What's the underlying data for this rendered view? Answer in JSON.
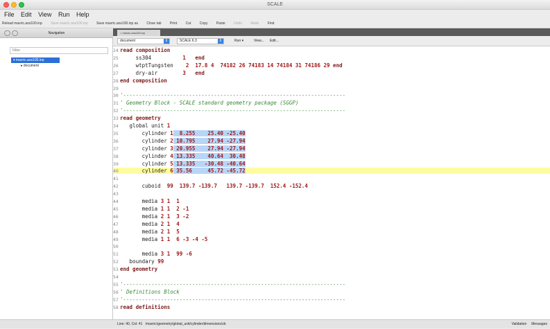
{
  "window": {
    "title": "SCALE"
  },
  "menu": [
    "File",
    "Edit",
    "View",
    "Run",
    "Help"
  ],
  "toolbar": [
    {
      "label": "Reload mavric.aos100.inp",
      "enabled": true
    },
    {
      "label": "Save mavric.aos100.inp",
      "enabled": false
    },
    {
      "label": "Save mavric.aos100.inp as",
      "enabled": true
    },
    {
      "label": "Close tab",
      "enabled": true
    },
    {
      "label": "Print",
      "enabled": true
    },
    {
      "label": "Cut",
      "enabled": true
    },
    {
      "label": "Copy",
      "enabled": true
    },
    {
      "label": "Paste",
      "enabled": true
    },
    {
      "label": "Undo",
      "enabled": false
    },
    {
      "label": "Redo",
      "enabled": false
    },
    {
      "label": "Find",
      "enabled": true
    }
  ],
  "navigation": {
    "title": "Navigation",
    "filter_placeholder": "Filter",
    "tree_root": "mavric.aos100.inp",
    "tree_child": "document"
  },
  "tab": {
    "label": "mavric.aos100.inp"
  },
  "editor_bar": {
    "mode": "document",
    "version": "SCALE 6.3",
    "run": "Run",
    "view": "View...",
    "edit": "Edit..."
  },
  "code_lines": [
    {
      "n": "24",
      "t": [
        [
          "kw",
          "read composition"
        ]
      ]
    },
    {
      "n": "25",
      "t": [
        [
          "",
          "     ss304          "
        ],
        [
          "num",
          "1"
        ],
        [
          "",
          "   "
        ],
        [
          "kw",
          "end"
        ]
      ]
    },
    {
      "n": "26",
      "t": [
        [
          "",
          "     wtptTungsten    "
        ],
        [
          "num",
          "2  17.8 4  74182 26 74183 14 74184 31 74186 29"
        ],
        [
          "",
          ""
        ],
        [
          "kw",
          " end"
        ]
      ]
    },
    {
      "n": "27",
      "t": [
        [
          "",
          "     dry-air        "
        ],
        [
          "num",
          "3"
        ],
        [
          "",
          "   "
        ],
        [
          "kw",
          "end"
        ]
      ]
    },
    {
      "n": "28",
      "t": [
        [
          "kw",
          "end composition"
        ]
      ]
    },
    {
      "n": "29",
      "t": [
        [
          "",
          ""
        ]
      ]
    },
    {
      "n": "30",
      "t": [
        [
          "cm",
          "'-----------------------------------------------------------------------"
        ]
      ]
    },
    {
      "n": "31",
      "t": [
        [
          "cm",
          "' Geometry Block - SCALE standard geometry package (SGGP)"
        ]
      ]
    },
    {
      "n": "32",
      "t": [
        [
          "cm",
          "'-----------------------------------------------------------------------"
        ]
      ]
    },
    {
      "n": "33",
      "t": [
        [
          "kw",
          "read geometry"
        ]
      ]
    },
    {
      "n": "34",
      "t": [
        [
          "",
          "   global unit "
        ],
        [
          "num",
          "1"
        ]
      ]
    },
    {
      "n": "35",
      "t": [
        [
          "",
          "       cylinder "
        ],
        [
          "num",
          "1"
        ],
        [
          "sel",
          "  "
        ],
        [
          "num sel",
          "8.255    25.40 -25.40"
        ]
      ]
    },
    {
      "n": "36",
      "t": [
        [
          "",
          "       cylinder "
        ],
        [
          "num",
          "2"
        ],
        [
          "sel",
          " "
        ],
        [
          "num sel",
          "10.795    27.94 -27.94"
        ]
      ]
    },
    {
      "n": "37",
      "t": [
        [
          "",
          "       cylinder "
        ],
        [
          "num",
          "3"
        ],
        [
          "sel",
          " "
        ],
        [
          "num sel",
          "20.955    27.94 -27.94"
        ]
      ]
    },
    {
      "n": "38",
      "t": [
        [
          "",
          "       cylinder "
        ],
        [
          "num",
          "4"
        ],
        [
          "sel",
          " "
        ],
        [
          "num sel",
          "13.335    40.64  30.48"
        ]
      ]
    },
    {
      "n": "39",
      "t": [
        [
          "",
          "       cylinder "
        ],
        [
          "num",
          "5"
        ],
        [
          "sel",
          " "
        ],
        [
          "num sel",
          "13.335   -30.48 -40.64"
        ]
      ]
    },
    {
      "n": "40",
      "t": [
        [
          "",
          "       cylinder "
        ],
        [
          "num",
          "6"
        ],
        [
          "sel",
          " "
        ],
        [
          "num sel",
          "35.56     45.72 -45.72"
        ]
      ],
      "current": true
    },
    {
      "n": "41",
      "t": [
        [
          "",
          ""
        ]
      ]
    },
    {
      "n": "42",
      "t": [
        [
          "",
          "       cuboid  "
        ],
        [
          "num",
          "99  139.7 -139.7   139.7 -139.7  152.4 -152.4"
        ]
      ]
    },
    {
      "n": "43",
      "t": [
        [
          "",
          ""
        ]
      ]
    },
    {
      "n": "44",
      "t": [
        [
          "",
          "       media "
        ],
        [
          "num",
          "3 1  1"
        ]
      ]
    },
    {
      "n": "45",
      "t": [
        [
          "",
          "       media "
        ],
        [
          "num",
          "1 1  2 -1"
        ]
      ]
    },
    {
      "n": "46",
      "t": [
        [
          "",
          "       media "
        ],
        [
          "num",
          "2 1  3 -2"
        ]
      ]
    },
    {
      "n": "47",
      "t": [
        [
          "",
          "       media "
        ],
        [
          "num",
          "2 1  4"
        ]
      ]
    },
    {
      "n": "48",
      "t": [
        [
          "",
          "       media "
        ],
        [
          "num",
          "2 1  5"
        ]
      ]
    },
    {
      "n": "49",
      "t": [
        [
          "",
          "       media "
        ],
        [
          "num",
          "1 1  6 -3 -4 -5"
        ]
      ]
    },
    {
      "n": "50",
      "t": [
        [
          "",
          ""
        ]
      ]
    },
    {
      "n": "51",
      "t": [
        [
          "",
          "       media "
        ],
        [
          "num",
          "3 1  99 -6"
        ]
      ]
    },
    {
      "n": "52",
      "t": [
        [
          "",
          "   boundary "
        ],
        [
          "num",
          "99"
        ]
      ]
    },
    {
      "n": "53",
      "t": [
        [
          "kw",
          "end geometry"
        ]
      ]
    },
    {
      "n": "54",
      "t": [
        [
          "",
          ""
        ]
      ]
    },
    {
      "n": "55",
      "t": [
        [
          "cm",
          "'-----------------------------------------------------------------------"
        ]
      ]
    },
    {
      "n": "56",
      "t": [
        [
          "cm",
          "' Definitions Block"
        ]
      ]
    },
    {
      "n": "57",
      "t": [
        [
          "cm",
          "'-----------------------------------------------------------------------"
        ]
      ]
    },
    {
      "n": "58",
      "t": [
        [
          "kw",
          "read definitions"
        ]
      ]
    }
  ],
  "status": {
    "position": "Line: 40, Col: 41",
    "path": "/mavric/geometry/global_unit/cylinder/dimensions/zb",
    "validation": "Validation",
    "messages": "Messages"
  }
}
